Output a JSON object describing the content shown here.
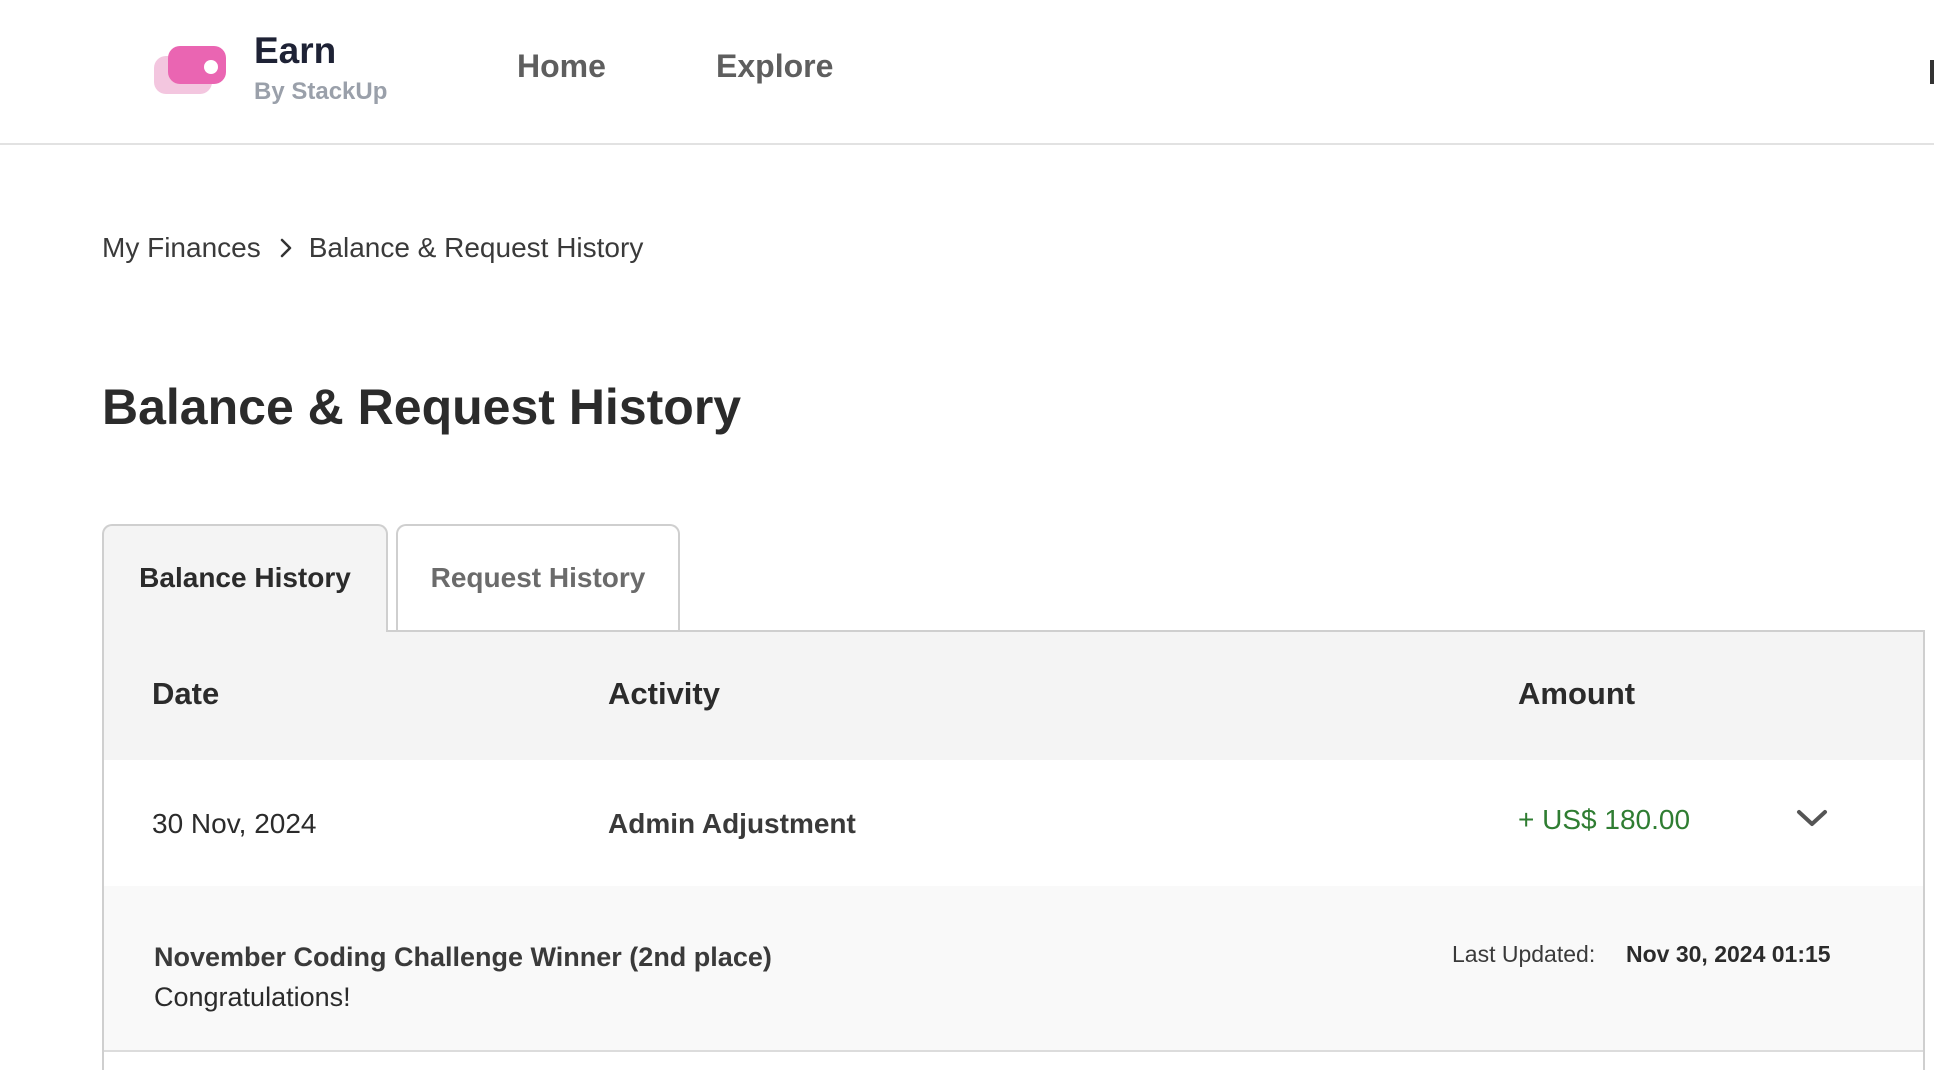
{
  "header": {
    "brand_name": "Earn",
    "brand_sub": "By StackUp",
    "nav": [
      {
        "label": "Home"
      },
      {
        "label": "Explore"
      }
    ]
  },
  "breadcrumb": {
    "items": [
      "My Finances",
      "Balance & Request History"
    ]
  },
  "page": {
    "title": "Balance & Request History"
  },
  "tabs": [
    {
      "label": "Balance History",
      "active": true
    },
    {
      "label": "Request History",
      "active": false
    }
  ],
  "table": {
    "columns": [
      "Date",
      "Activity",
      "Amount"
    ],
    "rows": [
      {
        "date": "30 Nov, 2024",
        "activity": "Admin Adjustment",
        "amount": "+ US$ 180.00",
        "expanded": true,
        "detail": {
          "title": "November Coding Challenge Winner (2nd place)",
          "message": "Congratulations!",
          "last_updated_label": "Last Updated:",
          "last_updated_value": "Nov 30, 2024 01:15"
        }
      }
    ]
  },
  "colors": {
    "brand_pink": "#ea65b2",
    "brand_pink_light": "#f3c6df",
    "amount_positive": "#2f7d32",
    "header_bg": "#f4f4f4"
  },
  "icons": {
    "logo": "earn-logo-icon",
    "breadcrumb_separator": "chevron-right-icon",
    "row_toggle": "chevron-down-icon"
  }
}
